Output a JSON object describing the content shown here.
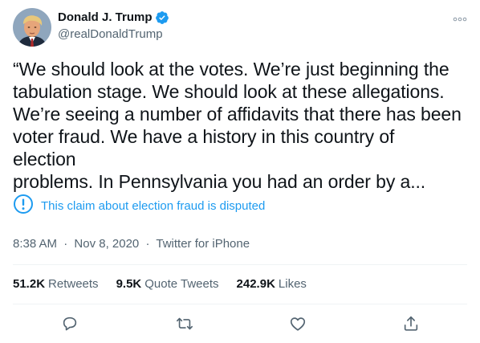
{
  "author": {
    "display_name": "Donald J. Trump",
    "handle": "@realDonaldTrump",
    "verified": true,
    "avatar_icon": "profile-photo"
  },
  "more_icon": "more-options-icon",
  "tweet": {
    "text": "“We should look at the votes. We’re just beginning the\ntabulation stage. We should look at these allegations.\nWe’re seeing a number of affidavits that there has been\nvoter fraud. We have a history in this country of election\nproblems. In Pennsylvania you had an order by a..."
  },
  "notice": {
    "icon": "exclamation-circle-icon",
    "text": "This claim about election fraud is disputed",
    "color": "#1d9bf0"
  },
  "meta": {
    "time": "8:38 AM",
    "date": "Nov 8, 2020",
    "separator": "·",
    "source": "Twitter for iPhone"
  },
  "stats": {
    "retweets": {
      "count": "51.2K",
      "label": "Retweets"
    },
    "quotes": {
      "count": "9.5K",
      "label": "Quote Tweets"
    },
    "likes": {
      "count": "242.9K",
      "label": "Likes"
    }
  },
  "actions": [
    "reply-icon",
    "retweet-icon",
    "like-icon",
    "share-icon"
  ],
  "colors": {
    "text": "#0f1419",
    "secondary": "#536471",
    "accent": "#1d9bf0",
    "divider": "#eff3f4"
  }
}
